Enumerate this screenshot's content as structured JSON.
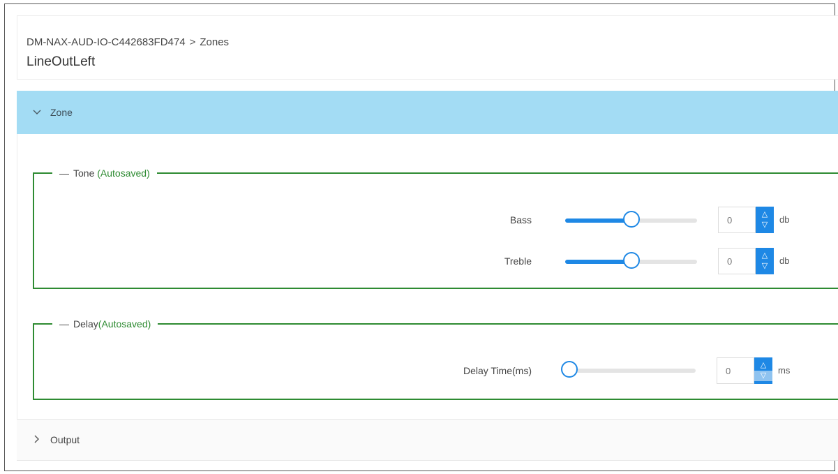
{
  "breadcrumb": {
    "device": "DM-NAX-AUD-IO-C442683FD474",
    "separator": ">",
    "section": "Zones"
  },
  "page_title": "LineOutLeft",
  "zone_panel": {
    "label": "Zone",
    "expanded": true
  },
  "tone": {
    "legend": "Tone",
    "status": "(Autosaved)",
    "bass": {
      "label": "Bass",
      "value": "0",
      "unit": "db",
      "level": 0.5
    },
    "treble": {
      "label": "Treble",
      "value": "0",
      "unit": "db",
      "level": 0.5
    }
  },
  "delay": {
    "legend": "Delay",
    "status": "(Autosaved)",
    "delay_time": {
      "label": "Delay Time(ms)",
      "value": "0",
      "unit": "ms",
      "level": 0.0
    }
  },
  "output_panel": {
    "label": "Output",
    "expanded": false
  },
  "icons": {
    "collapse": "chevron-down-icon",
    "expand": "chevron-right-icon",
    "up": "triangle-up-icon",
    "down": "triangle-down-icon"
  },
  "colors": {
    "accent": "#1e88e5",
    "zone_header": "#a3dcf4",
    "autosaved": "#2e8b32"
  }
}
